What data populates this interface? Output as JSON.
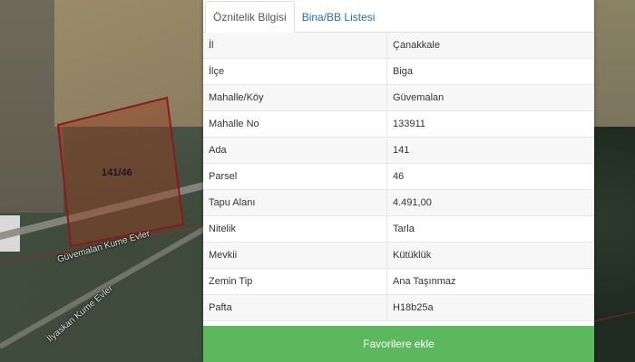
{
  "map": {
    "parcel_label": "141/46",
    "road_label_1": "Güvemalan Kume Evler",
    "road_label_2": "İlyaskan Kume Evler",
    "parcel_color": "#8b1a1a"
  },
  "tabs": [
    {
      "label": "Öznitelik Bilgisi",
      "active": true
    },
    {
      "label": "Bina/BB Listesi",
      "active": false
    }
  ],
  "attributes": [
    {
      "key": "İl",
      "value": "Çanakkale"
    },
    {
      "key": "İlçe",
      "value": "Biga"
    },
    {
      "key": "Mahalle/Köy",
      "value": "Güvemalan"
    },
    {
      "key": "Mahalle No",
      "value": "133911"
    },
    {
      "key": "Ada",
      "value": "141"
    },
    {
      "key": "Parsel",
      "value": "46"
    },
    {
      "key": "Tapu Alanı",
      "value": "4.491,00"
    },
    {
      "key": "Nitelik",
      "value": "Tarla"
    },
    {
      "key": "Mevkii",
      "value": "Kütüklük"
    },
    {
      "key": "Zemin Tip",
      "value": "Ana Taşınmaz"
    },
    {
      "key": "Pafta",
      "value": "H18b25a"
    }
  ],
  "favorites_button": {
    "label": "Favorilere ekle",
    "color": "#5cb85c"
  }
}
